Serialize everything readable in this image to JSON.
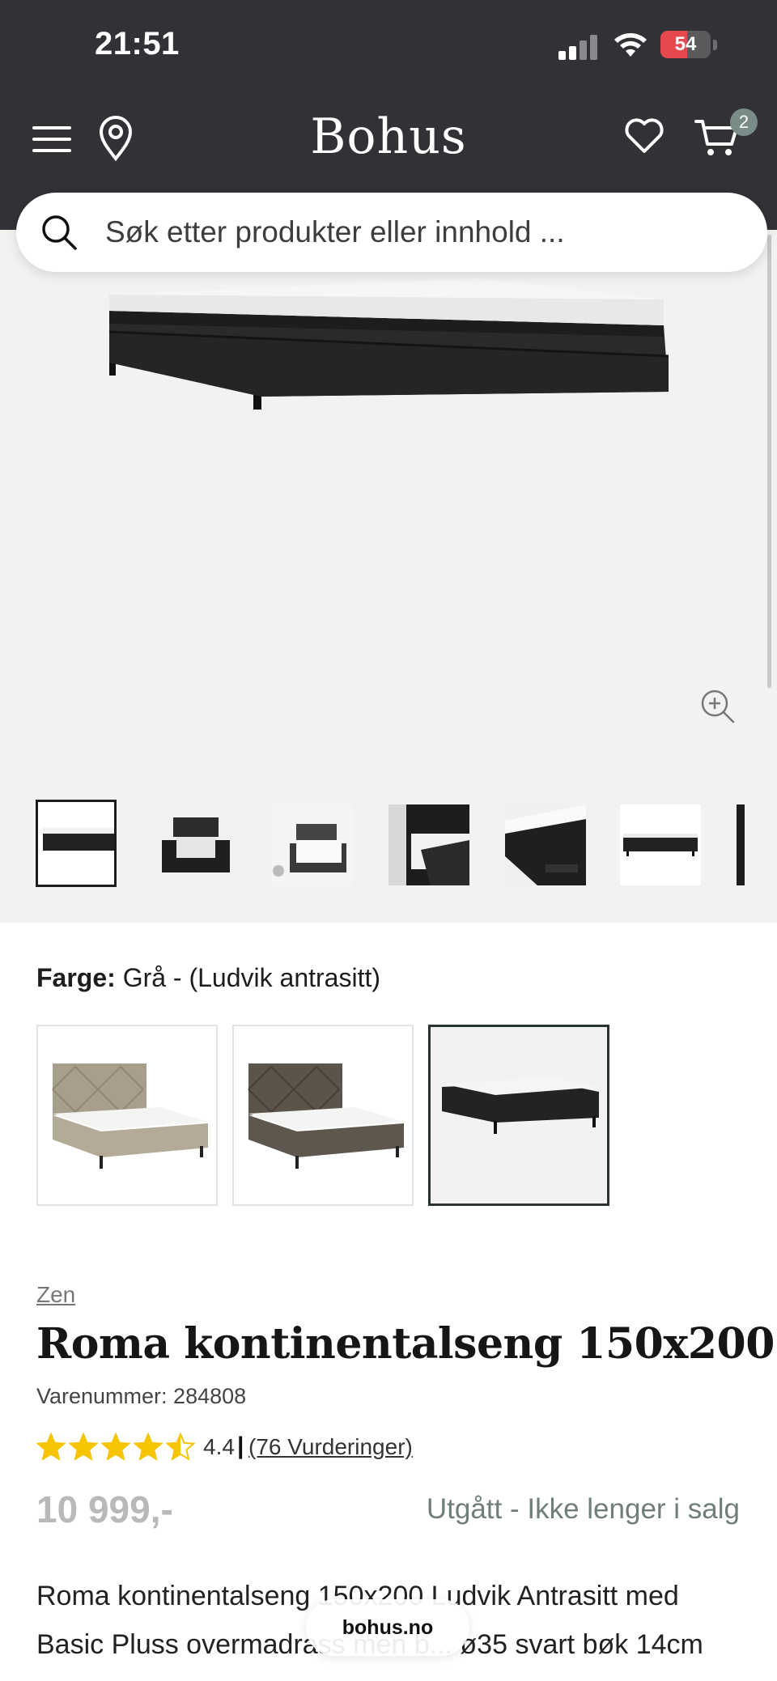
{
  "status_bar": {
    "time": "21:51",
    "battery_level": "54",
    "battery_color": "#e5484d"
  },
  "header": {
    "logo": "Bohus",
    "cart_count": "2",
    "icons": [
      "menu-icon",
      "location-pin-icon",
      "heart-icon",
      "cart-icon"
    ]
  },
  "search": {
    "placeholder": "Søk etter produkter eller innhold ..."
  },
  "gallery": {
    "thumbnail_count": 7,
    "active_thumbnail": 1
  },
  "color_selector": {
    "label": "Farge:",
    "value": "Grå - (Ludvik antrasitt)",
    "options": [
      "beige",
      "brown",
      "anthracite"
    ],
    "selected": 3
  },
  "product": {
    "brand": "Zen",
    "title": "Roma kontinentalseng 150x200",
    "sku": "Varenummer: 284808",
    "rating": {
      "stars": 4.5,
      "score": "4.4",
      "separator": "|",
      "count": "(76 Vurderinger)"
    },
    "price": "10 999,-",
    "availability": "Utgått - Ikke lenger i salg",
    "description": "Roma kontinentalseng 150x200 Ludvik Antrasitt med Basic Pluss overmadrass men b... ø35 svart bøk 14cm"
  },
  "browser": {
    "url": "bohus.no"
  },
  "colors": {
    "header_bg": "#323236",
    "gallery_bg": "#f3f2f0",
    "star": "#f6c400",
    "availability": "#6f7e7a"
  }
}
